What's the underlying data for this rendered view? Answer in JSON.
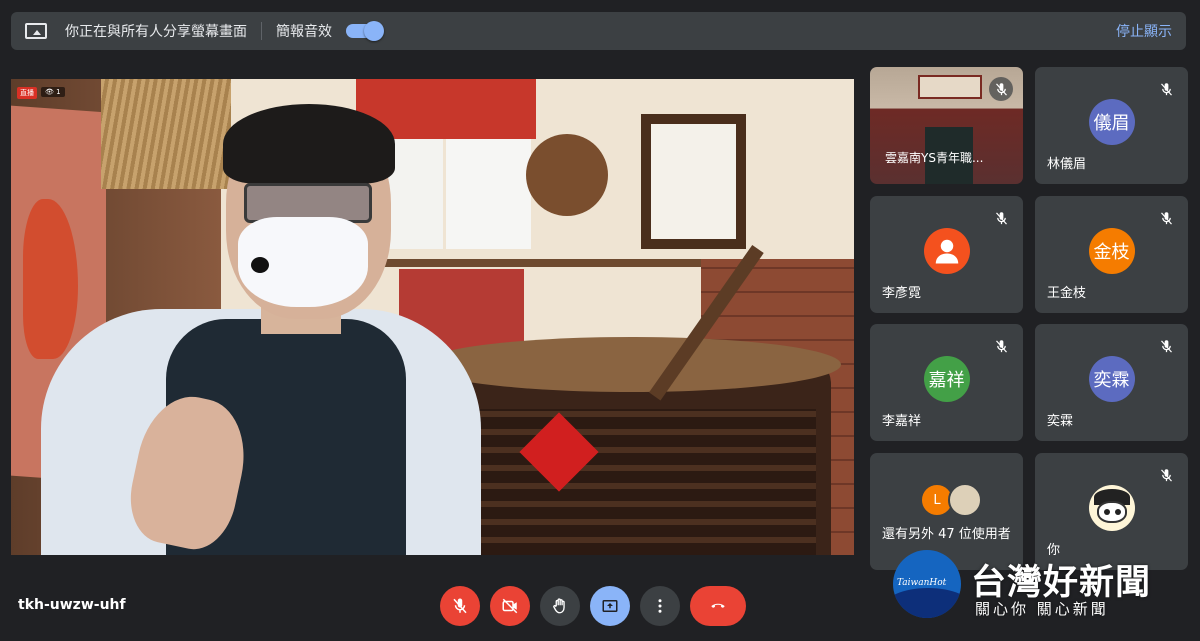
{
  "share_banner": {
    "message": "你正在與所有人分享螢幕畫面",
    "sound_label": "簡報音效",
    "sound_enabled": true,
    "stop_label": "停止顯示"
  },
  "main_video": {
    "live_badge": "直播",
    "viewer_count": "1"
  },
  "participants": [
    {
      "name": "雲嘉南YS青年職...",
      "type": "video",
      "muted": true
    },
    {
      "name": "林儀眉",
      "avatar_text": "儀眉",
      "avatar_color": "#5c6bc0",
      "muted": true
    },
    {
      "name": "李彥霓",
      "avatar_text": "",
      "avatar_color": "#f4511e",
      "muted": true
    },
    {
      "name": "王金枝",
      "avatar_text": "金枝",
      "avatar_color": "#f57c00",
      "muted": true
    },
    {
      "name": "李嘉祥",
      "avatar_text": "嘉祥",
      "avatar_color": "#43a047",
      "muted": true
    },
    {
      "name": "奕霖",
      "avatar_text": "奕霖",
      "avatar_color": "#5c6bc0",
      "muted": true
    },
    {
      "name": "還有另外 47 位使用者",
      "avatar_text": "L",
      "avatar_color": "#f57c00",
      "muted": false
    },
    {
      "name": "你",
      "type": "self",
      "muted": true
    }
  ],
  "meeting": {
    "code": "tkh-uwzw-uhf"
  },
  "controls": {
    "mic": "mic-off-icon",
    "camera": "camera-off-icon",
    "hand": "raise-hand-icon",
    "present": "present-screen-icon",
    "more": "more-options-icon",
    "end": "end-call-icon"
  },
  "watermark": {
    "logo_text": "TaiwanHot",
    "title": "台灣好新聞",
    "subtitle": "關心你 關心新聞"
  },
  "colors": {
    "background": "#202124",
    "tile": "#3c4043",
    "accent": "#8ab4f8",
    "danger": "#ea4335"
  }
}
